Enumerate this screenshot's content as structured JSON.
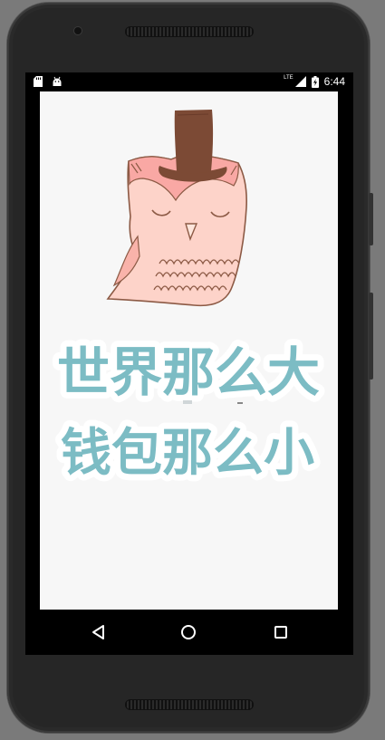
{
  "status_bar": {
    "time": "6:44",
    "network": "LTE",
    "icons": [
      "sd-card-icon",
      "android-icon",
      "signal-icon",
      "battery-charging-icon"
    ]
  },
  "app": {
    "illustration": "owl-with-top-hat",
    "slogan_line_1": "世界那么大",
    "slogan_line_2": "钱包那么小"
  },
  "navigation": {
    "buttons": [
      "back-button",
      "home-button",
      "recents-button"
    ]
  },
  "colors": {
    "slogan": "#7cbcc4",
    "owl_body": "#fdd3c9",
    "owl_outline": "#8c5a45",
    "hat": "#7c4a35",
    "screen_bg": "#f7f7f7"
  }
}
